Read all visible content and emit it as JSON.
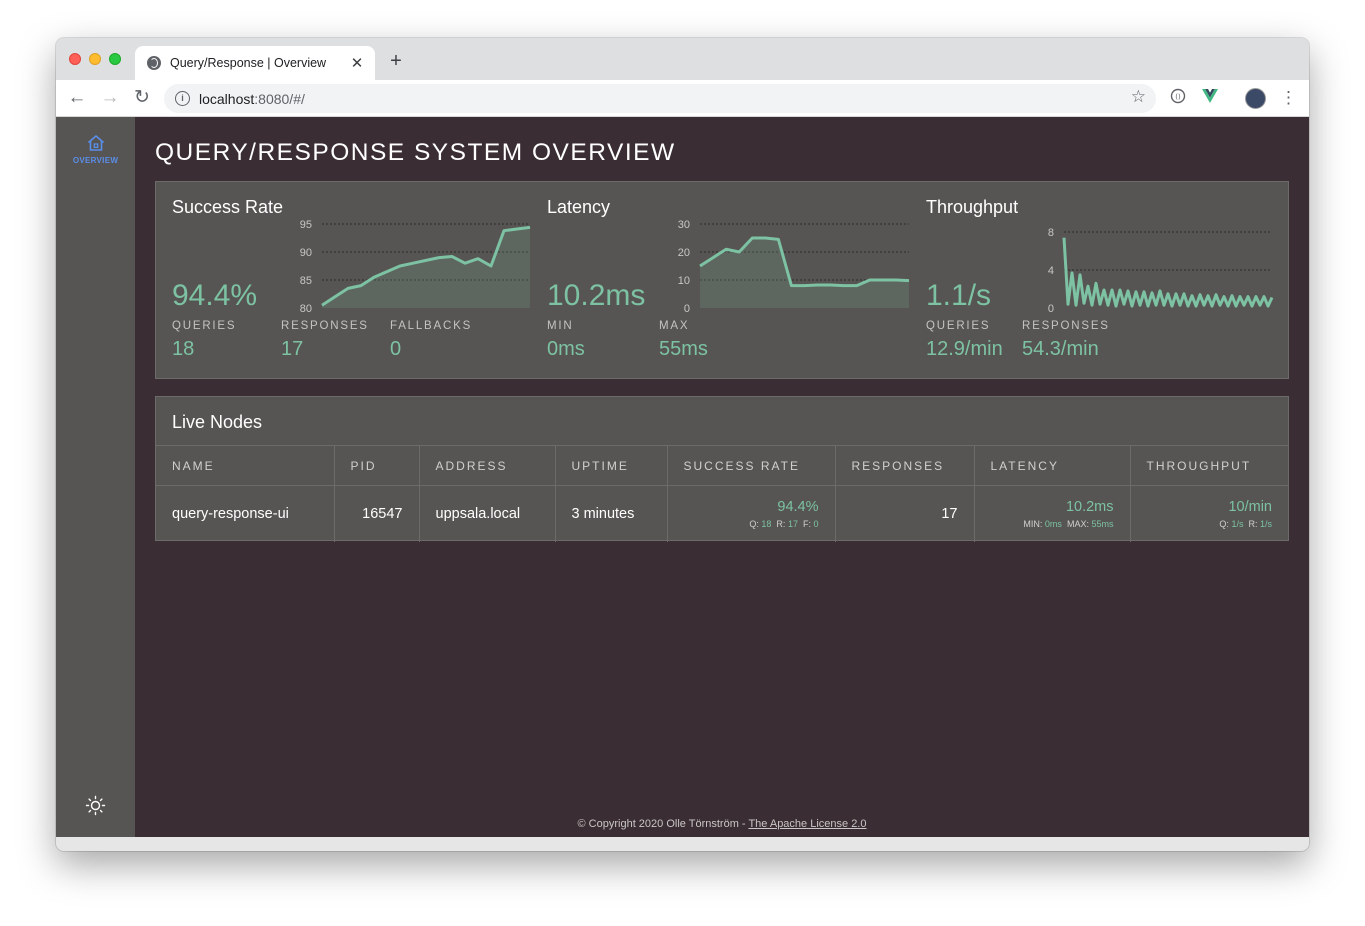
{
  "browser": {
    "tab_title": "Query/Response | Overview",
    "tab_close": "✕",
    "new_tab": "+",
    "url_host": "localhost",
    "url_rest": ":8080/#/",
    "back": "←",
    "forward": "→",
    "reload": "↻",
    "star": "☆",
    "menu": "⋮"
  },
  "sidebar": {
    "items": [
      {
        "label": "OVERVIEW",
        "icon": "home-icon",
        "active": true
      }
    ],
    "theme_icon": "sun-icon"
  },
  "page": {
    "title": "QUERY/RESPONSE SYSTEM OVERVIEW"
  },
  "success_rate": {
    "title": "Success Rate",
    "value": "94.4%",
    "stats": [
      {
        "label": "QUERIES",
        "value": "18"
      },
      {
        "label": "RESPONSES",
        "value": "17"
      },
      {
        "label": "FALLBACKS",
        "value": "0"
      }
    ]
  },
  "latency": {
    "title": "Latency",
    "value": "10.2ms",
    "stats": [
      {
        "label": "MIN",
        "value": "0ms"
      },
      {
        "label": "MAX",
        "value": "55ms"
      }
    ]
  },
  "throughput": {
    "title": "Throughput",
    "value": "1.1/s",
    "stats": [
      {
        "label": "QUERIES",
        "value": "12.9/min"
      },
      {
        "label": "RESPONSES",
        "value": "54.3/min"
      }
    ]
  },
  "chart_data": [
    {
      "type": "area",
      "ylim": [
        80,
        95
      ],
      "yticks": [
        "95",
        "90",
        "85",
        "80"
      ],
      "grid": true,
      "values": [
        80.5,
        82,
        83.5,
        84,
        85.5,
        86.5,
        87.5,
        88,
        88.5,
        89,
        89.2,
        88,
        88.8,
        87.5,
        93.8,
        94.1,
        94.4
      ]
    },
    {
      "type": "area",
      "ylim": [
        0,
        30
      ],
      "yticks": [
        "30",
        "20",
        "10",
        "0"
      ],
      "grid": true,
      "values": [
        15,
        18,
        21,
        20,
        25,
        25,
        24.5,
        8,
        8,
        8.2,
        8.2,
        8,
        8,
        10,
        10,
        10,
        9.8
      ]
    },
    {
      "type": "line",
      "ylim": [
        0,
        8
      ],
      "yticks": [
        "8",
        "4",
        "0"
      ],
      "grid": true,
      "values": [
        7.4,
        0.4,
        3.7,
        0.3,
        3.5,
        0.5,
        2.3,
        0.3,
        2.6,
        0.4,
        1.9,
        0.3,
        1.9,
        0.2,
        1.9,
        0.4,
        1.8,
        0.2,
        1.7,
        0.3,
        1.7,
        0.2,
        1.6,
        0.3,
        1.8,
        0.3,
        1.5,
        0.2,
        1.5,
        0.3,
        1.5,
        0.2,
        1.3,
        0.2,
        1.4,
        0.3,
        1.3,
        0.2,
        1.4,
        0.3,
        1.2,
        0.2,
        1.3,
        0.2,
        1.2,
        0.3,
        1.2,
        0.2,
        1.2,
        0.3,
        1.2,
        0.2,
        1.1
      ]
    }
  ],
  "nodes": {
    "title": "Live Nodes",
    "columns": [
      "NAME",
      "PID",
      "ADDRESS",
      "UPTIME",
      "SUCCESS RATE",
      "RESPONSES",
      "LATENCY",
      "THROUGHPUT"
    ],
    "rows": [
      {
        "name": "query-response-ui",
        "pid": "16547",
        "address": "uppsala.local",
        "uptime": "3 minutes",
        "success_rate": "94.4%",
        "sr_q_label": "Q:",
        "sr_q": "18",
        "sr_r_label": "R:",
        "sr_r": "17",
        "sr_f_label": "F:",
        "sr_f": "0",
        "responses": "17",
        "latency": "10.2ms",
        "lat_min_label": "MIN:",
        "lat_min": "0ms",
        "lat_max_label": "MAX:",
        "lat_max": "55ms",
        "throughput": "10/min",
        "tp_q_label": "Q:",
        "tp_q": "1/s",
        "tp_r_label": "R:",
        "tp_r": "1/s"
      }
    ]
  },
  "footer": {
    "text": "© Copyright 2020 Olle Törnström - ",
    "link": "The Apache License 2.0"
  },
  "colors": {
    "accent": "#7cc2a3",
    "background": "#3a2d33",
    "panel": "#575553",
    "nav_active": "#5a8ee8"
  }
}
